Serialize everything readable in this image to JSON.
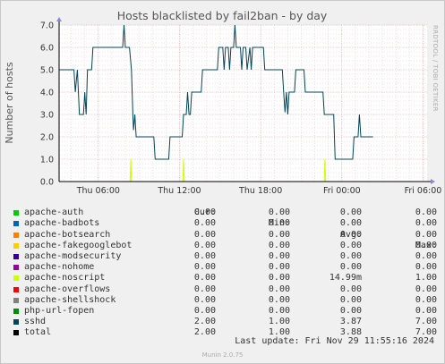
{
  "chart_data": {
    "type": "line",
    "title": "Hosts blacklisted by fail2ban - by day",
    "ylabel": "Number of hosts",
    "side_text": "RRDTOOL / TOBI OETIKER",
    "ylim": [
      0,
      7
    ],
    "yticks": [
      "0.0",
      "1.0",
      "2.0",
      "3.0",
      "4.0",
      "5.0",
      "6.0",
      "7.0"
    ],
    "x_start_hours": 3.1,
    "x_end_hours": 30.3,
    "xticks": [
      {
        "label": "Thu 06:00",
        "hour": 6
      },
      {
        "label": "Thu 12:00",
        "hour": 12
      },
      {
        "label": "Thu 18:00",
        "hour": 18
      },
      {
        "label": "Fri 00:00",
        "hour": 24
      },
      {
        "label": "Fri 06:00",
        "hour": 30
      }
    ],
    "series": [
      {
        "name": "sshd",
        "color": "#00455a",
        "points": [
          [
            3.1,
            5
          ],
          [
            4.2,
            5
          ],
          [
            4.3,
            4
          ],
          [
            4.45,
            5
          ],
          [
            4.6,
            3
          ],
          [
            4.9,
            3
          ],
          [
            5,
            4
          ],
          [
            5.1,
            3
          ],
          [
            5.2,
            5
          ],
          [
            5.5,
            5
          ],
          [
            5.6,
            6
          ],
          [
            6.8,
            6
          ],
          [
            7.8,
            6
          ],
          [
            7.9,
            7
          ],
          [
            8.0,
            6
          ],
          [
            8.3,
            6
          ],
          [
            8.45,
            5
          ],
          [
            8.55,
            3
          ],
          [
            8.6,
            2.3
          ],
          [
            8.7,
            3
          ],
          [
            8.8,
            2
          ],
          [
            10.1,
            2
          ],
          [
            10.2,
            1
          ],
          [
            11.2,
            1
          ],
          [
            11.3,
            2
          ],
          [
            12.2,
            2
          ],
          [
            12.3,
            3
          ],
          [
            12.5,
            3
          ],
          [
            12.6,
            4
          ],
          [
            12.7,
            3
          ],
          [
            12.8,
            3
          ],
          [
            12.9,
            4
          ],
          [
            13.6,
            4
          ],
          [
            13.7,
            5
          ],
          [
            14.8,
            5
          ],
          [
            14.9,
            6
          ],
          [
            15.2,
            6
          ],
          [
            15.3,
            5
          ],
          [
            15.4,
            6
          ],
          [
            15.6,
            6
          ],
          [
            15.7,
            5
          ],
          [
            15.8,
            6
          ],
          [
            16,
            6
          ],
          [
            16.1,
            7
          ],
          [
            16.2,
            6
          ],
          [
            16.5,
            6
          ],
          [
            16.6,
            5
          ],
          [
            16.7,
            6
          ],
          [
            16.9,
            6
          ],
          [
            17.0,
            5
          ],
          [
            17.2,
            6
          ],
          [
            17.3,
            5
          ],
          [
            17.4,
            6
          ],
          [
            18.2,
            6
          ],
          [
            18.3,
            5
          ],
          [
            19.6,
            5
          ],
          [
            19.7,
            4
          ],
          [
            19.8,
            3.1
          ],
          [
            19.9,
            4
          ],
          [
            20,
            3
          ],
          [
            20.1,
            4
          ],
          [
            20.5,
            4
          ],
          [
            20.6,
            5
          ],
          [
            21.2,
            5
          ],
          [
            21.3,
            4
          ],
          [
            22.6,
            4
          ],
          [
            22.7,
            3
          ],
          [
            23.4,
            3
          ],
          [
            23.5,
            1
          ],
          [
            24.8,
            1
          ],
          [
            24.9,
            2
          ],
          [
            25.2,
            2
          ],
          [
            25.3,
            3
          ],
          [
            25.4,
            2
          ],
          [
            26.3,
            2
          ]
        ]
      },
      {
        "name": "apache-noscript",
        "color": "#ccff00",
        "points": [
          [
            3.1,
            0
          ],
          [
            8.35,
            0
          ],
          [
            8.4,
            1
          ],
          [
            8.45,
            0
          ],
          [
            12.25,
            0
          ],
          [
            12.3,
            1
          ],
          [
            12.35,
            0
          ],
          [
            22.7,
            0
          ],
          [
            22.75,
            1
          ],
          [
            22.8,
            0
          ],
          [
            26.3,
            0
          ]
        ]
      }
    ],
    "grid": true
  },
  "legend": {
    "headers": {
      "cur": "Cur:",
      "min": "Min:",
      "avg": "Avg:",
      "max": "Max:"
    },
    "rows": [
      {
        "name": "apache-auth",
        "color": "#00cc00",
        "cur": "0.00",
        "min": "0.00",
        "avg": "0.00",
        "max": "0.00"
      },
      {
        "name": "apache-badbots",
        "color": "#0066b3",
        "cur": "0.00",
        "min": "0.00",
        "avg": "0.00",
        "max": "0.00"
      },
      {
        "name": "apache-botsearch",
        "color": "#ff8000",
        "cur": "0.00",
        "min": "0.00",
        "avg": "0.00",
        "max": "0.00"
      },
      {
        "name": "apache-fakegooglebot",
        "color": "#ffcc00",
        "cur": "0.00",
        "min": "0.00",
        "avg": "0.00",
        "max": "0.00"
      },
      {
        "name": "apache-modsecurity",
        "color": "#330099",
        "cur": "0.00",
        "min": "0.00",
        "avg": "0.00",
        "max": "0.00"
      },
      {
        "name": "apache-nohome",
        "color": "#990099",
        "cur": "0.00",
        "min": "0.00",
        "avg": "0.00",
        "max": "0.00"
      },
      {
        "name": "apache-noscript",
        "color": "#ccff00",
        "cur": "0.00",
        "min": "0.00",
        "avg": "14.99m",
        "max": "1.00"
      },
      {
        "name": "apache-overflows",
        "color": "#ff0000",
        "cur": "0.00",
        "min": "0.00",
        "avg": "0.00",
        "max": "0.00"
      },
      {
        "name": "apache-shellshock",
        "color": "#808080",
        "cur": "0.00",
        "min": "0.00",
        "avg": "0.00",
        "max": "0.00"
      },
      {
        "name": "php-url-fopen",
        "color": "#008f00",
        "cur": "0.00",
        "min": "0.00",
        "avg": "0.00",
        "max": "0.00"
      },
      {
        "name": "sshd",
        "color": "#00455a",
        "cur": "2.00",
        "min": "1.00",
        "avg": "3.87",
        "max": "7.00"
      },
      {
        "name": "total",
        "color": "#000000",
        "cur": "2.00",
        "min": "1.00",
        "avg": "3.88",
        "max": "7.00"
      }
    ]
  },
  "footer": {
    "last_update": "Last update: Fri Nov 29 11:55:16 2024",
    "munin": "Munin 2.0.75"
  }
}
